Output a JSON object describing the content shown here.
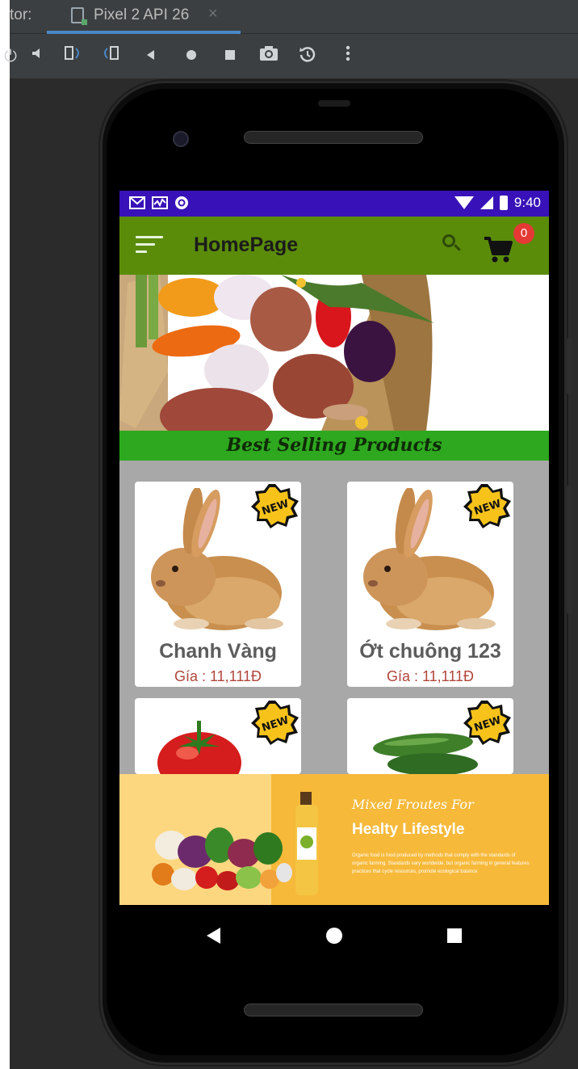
{
  "ide": {
    "prefix": "tor:",
    "tab_title": "Pixel 2 API 26",
    "tab_close": "×",
    "toolbar": [
      {
        "name": "power-icon",
        "glyph": "⏻"
      },
      {
        "name": "volume-icon",
        "glyph": "🔈"
      },
      {
        "name": "rotate-left-icon",
        "glyph": "⟲"
      },
      {
        "name": "rotate-right-icon",
        "glyph": "⟳"
      },
      {
        "name": "back-icon",
        "glyph": "◀"
      },
      {
        "name": "home-icon",
        "glyph": "●"
      },
      {
        "name": "overview-icon",
        "glyph": "■"
      },
      {
        "name": "camera-icon",
        "glyph": "📷"
      },
      {
        "name": "snapshot-icon",
        "glyph": "↺"
      },
      {
        "name": "more-icon",
        "glyph": "⋮"
      }
    ]
  },
  "statusbar": {
    "time": "9:40",
    "icons": [
      "gmail-icon",
      "activity-icon",
      "sync-icon"
    ]
  },
  "appbar": {
    "title": "HomePage",
    "cart_count": "0"
  },
  "colors": {
    "appbar": "#5a8c0a",
    "statusbar": "#3812b8",
    "banner": "#2ea81f",
    "price": "#b0463c",
    "badge": "#e53935"
  },
  "banner": {
    "title": "Best Selling Products"
  },
  "products": [
    {
      "name": "Chanh Vàng",
      "price": "Gía : 11,111Đ",
      "image": "rabbit-image",
      "badge": "NEW"
    },
    {
      "name": "Ớt chuông 123",
      "price": "Gía : 11,111Đ",
      "image": "rabbit-image",
      "badge": "NEW"
    },
    {
      "name": "",
      "price": "",
      "image": "tomato-image",
      "badge": "NEW"
    },
    {
      "name": "",
      "price": "",
      "image": "cucumber-image",
      "badge": "NEW"
    }
  ],
  "promo": {
    "title_line1": "Mixed Froutes For",
    "title_line2": "Healty Lifestyle",
    "body": "Organic food is food produced by methods that comply with the standards of organic farming. Standards vary worldwide, but organic farming in general features practices that cycle resources, promote ecological balance"
  }
}
